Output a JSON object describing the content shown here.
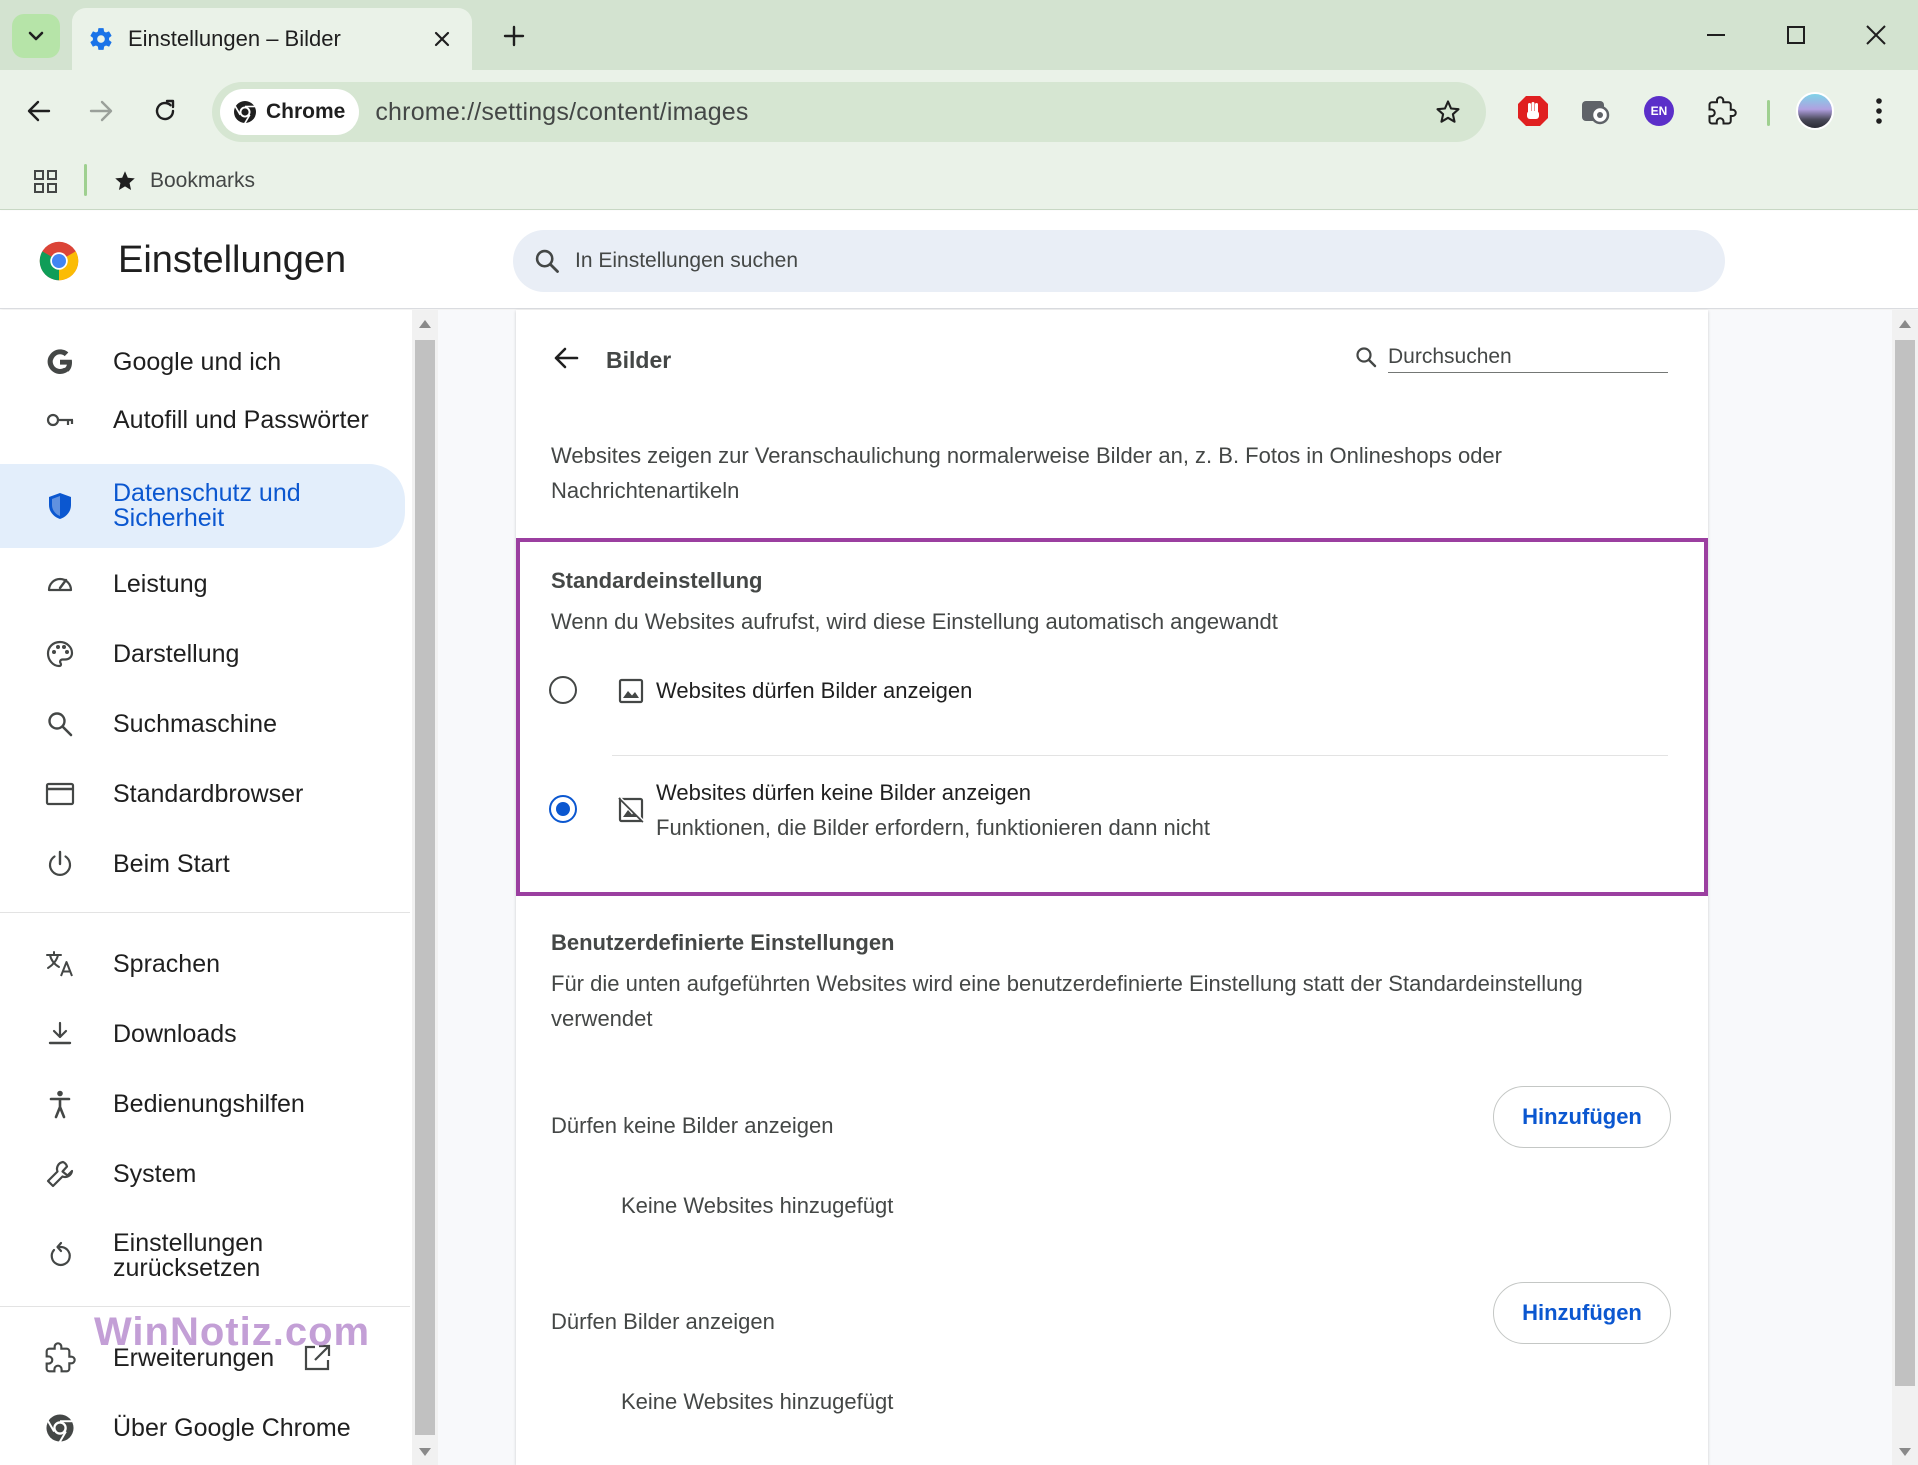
{
  "browser": {
    "tab_title": "Einstellungen – Bilder",
    "omnibox_chip": "Chrome",
    "url": "chrome://settings/content/images",
    "bookmarks_label": "Bookmarks",
    "extension_badge": "EN"
  },
  "settings": {
    "title": "Einstellungen",
    "search_placeholder": "In Einstellungen suchen"
  },
  "sidebar": {
    "items": [
      {
        "label": "Google und ich",
        "icon": "google-icon"
      },
      {
        "label": "Autofill und Passwörter",
        "icon": "key-icon"
      },
      {
        "label": "Datenschutz und Sicherheit",
        "icon": "shield-icon",
        "active": true
      },
      {
        "label": "Leistung",
        "icon": "speedometer-icon"
      },
      {
        "label": "Darstellung",
        "icon": "palette-icon"
      },
      {
        "label": "Suchmaschine",
        "icon": "search-icon"
      },
      {
        "label": "Standardbrowser",
        "icon": "browser-window-icon"
      },
      {
        "label": "Beim Start",
        "icon": "power-icon"
      },
      {
        "label": "Sprachen",
        "icon": "translate-icon"
      },
      {
        "label": "Downloads",
        "icon": "download-icon"
      },
      {
        "label": "Bedienungshilfen",
        "icon": "accessibility-icon"
      },
      {
        "label": "System",
        "icon": "wrench-icon"
      },
      {
        "label": "Einstellungen zurücksetzen",
        "icon": "reset-icon"
      },
      {
        "label": "Erweiterungen",
        "icon": "puzzle-icon"
      },
      {
        "label": "Über Google Chrome",
        "icon": "chrome-icon"
      }
    ],
    "watermark": "WinNotiz.com"
  },
  "page": {
    "title": "Bilder",
    "search_placeholder": "Durchsuchen",
    "description": "Websites zeigen zur Veranschaulichung normalerweise Bilder an, z. B. Fotos in Onlineshops oder Nachrichtenartikeln",
    "default_section": {
      "title": "Standardeinstellung",
      "subtitle": "Wenn du Websites aufrufst, wird diese Einstellung automatisch angewandt",
      "options": [
        {
          "label": "Websites dürfen Bilder anzeigen",
          "sublabel": "",
          "checked": false,
          "icon": "image-icon"
        },
        {
          "label": "Websites dürfen keine Bilder anzeigen",
          "sublabel": "Funktionen, die Bilder erfordern, funktionieren dann nicht",
          "checked": true,
          "icon": "image-off-icon"
        }
      ]
    },
    "custom_section": {
      "title": "Benutzerdefinierte Einstellungen",
      "subtitle": "Für die unten aufgeführten Websites wird eine benutzerdefinierte Einstellung statt der Standardeinstellung verwendet",
      "lists": [
        {
          "label": "Dürfen keine Bilder anzeigen",
          "button": "Hinzufügen",
          "empty": "Keine Websites hinzugefügt"
        },
        {
          "label": "Dürfen Bilder anzeigen",
          "button": "Hinzufügen",
          "empty": "Keine Websites hinzugefügt"
        }
      ]
    }
  },
  "colors": {
    "accent": "#0b57d0",
    "highlight_border": "#9b3fa0",
    "titlebar": "#d3e3d0"
  }
}
